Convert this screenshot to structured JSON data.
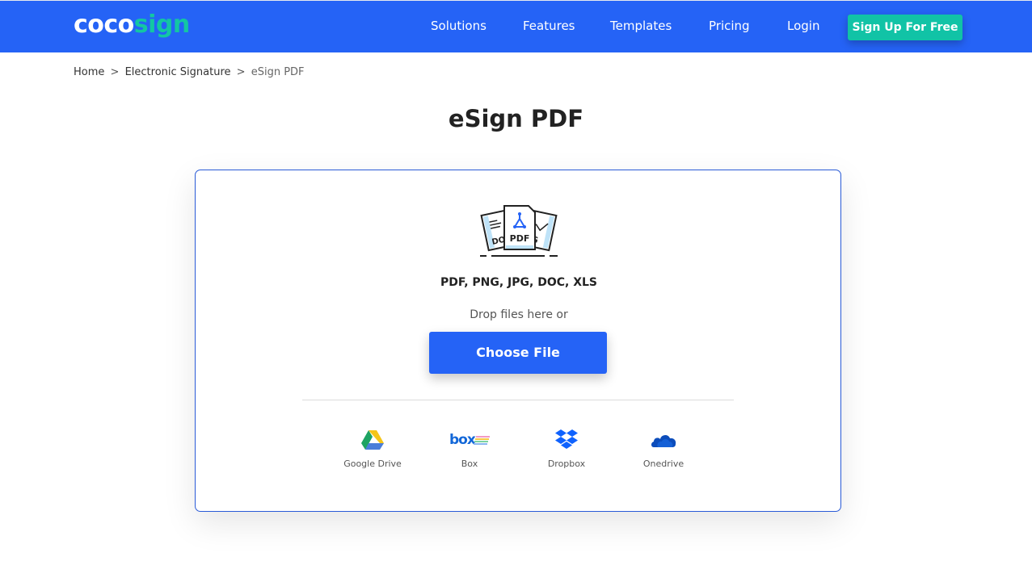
{
  "header": {
    "logo_part1": "coco",
    "logo_part2": "sign",
    "nav": [
      "Solutions",
      "Features",
      "Templates",
      "Pricing",
      "Login"
    ],
    "cta": "Sign Up For Free"
  },
  "colors": {
    "brand_blue": "#2563f6",
    "brand_teal": "#11c3a6"
  },
  "breadcrumb": {
    "items": [
      "Home",
      "Electronic Signature"
    ],
    "current": "eSign PDF",
    "separator": ">"
  },
  "page_title": "eSign PDF",
  "upload": {
    "icon": "document-stack-icon",
    "icon_badge": "PDF",
    "formats": "PDF, PNG, JPG, DOC, XLS",
    "drop_text": "Drop files here or",
    "button": "Choose File"
  },
  "sources": [
    {
      "label": "Google Drive",
      "icon": "google-drive-icon"
    },
    {
      "label": "Box",
      "icon": "box-icon"
    },
    {
      "label": "Dropbox",
      "icon": "dropbox-icon"
    },
    {
      "label": "Onedrive",
      "icon": "onedrive-icon"
    }
  ]
}
